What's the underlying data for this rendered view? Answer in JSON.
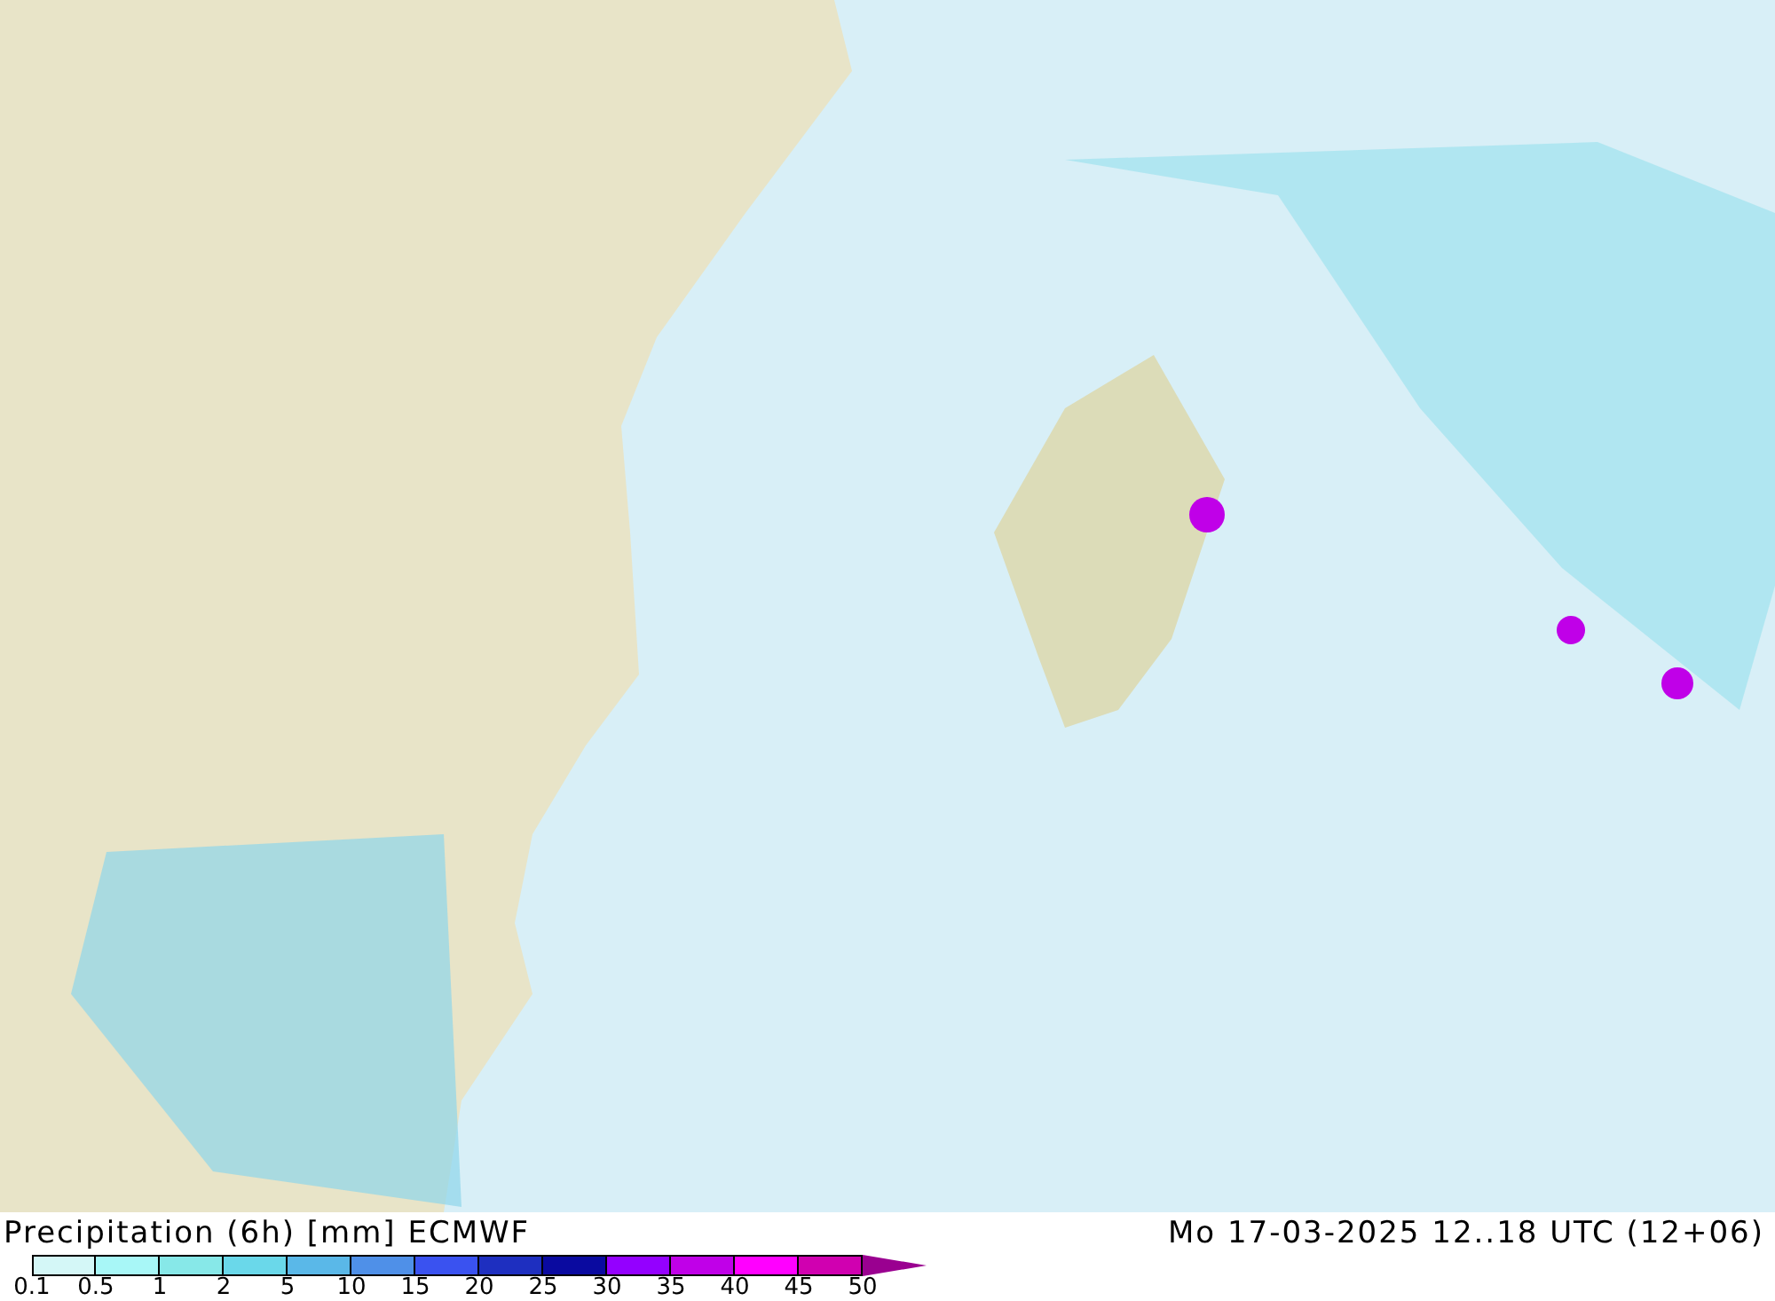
{
  "map": {
    "title": "Precipitation (6h) [mm] ECMWF",
    "valid_time": "Mo 17-03-2025 12..18 UTC (12+06)"
  },
  "legend": {
    "bins": [
      {
        "color": "#d4f7f7"
      },
      {
        "color": "#a8f7f7"
      },
      {
        "color": "#87e8e8"
      },
      {
        "color": "#6ad8ea"
      },
      {
        "color": "#5ab8e8"
      },
      {
        "color": "#4f90e8"
      },
      {
        "color": "#3a52f0"
      },
      {
        "color": "#1e2fc0"
      },
      {
        "color": "#0a0aa0"
      },
      {
        "color": "#9400ff"
      },
      {
        "color": "#c000e8"
      },
      {
        "color": "#ff00ff"
      },
      {
        "color": "#d000b0"
      },
      {
        "kind": "arrow",
        "color": "#9a0090"
      }
    ],
    "labels": [
      "0.1",
      "0.5",
      "1",
      "2",
      "5",
      "10",
      "15",
      "20",
      "25",
      "30",
      "35",
      "40",
      "45",
      "50"
    ]
  }
}
